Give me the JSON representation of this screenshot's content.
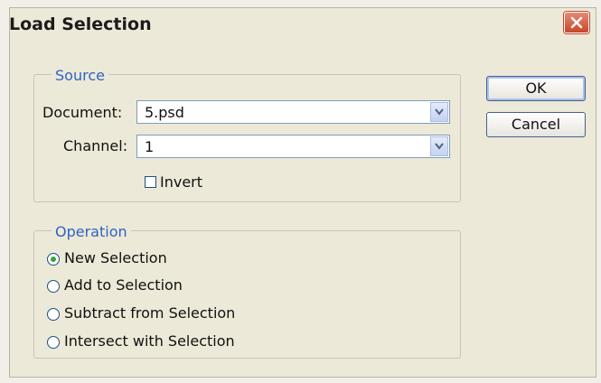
{
  "window": {
    "title": "Load Selection"
  },
  "source": {
    "legend": "Source",
    "document_label": "Document:",
    "document_value": "5.psd",
    "channel_label": "Channel:",
    "channel_value": "1",
    "invert_label": "Invert",
    "invert_checked": false
  },
  "operation": {
    "legend": "Operation",
    "options": [
      {
        "label": "New Selection",
        "selected": true
      },
      {
        "label": "Add to Selection",
        "selected": false
      },
      {
        "label": "Subtract from Selection",
        "selected": false
      },
      {
        "label": "Intersect with Selection",
        "selected": false
      }
    ]
  },
  "buttons": {
    "ok": "OK",
    "cancel": "Cancel"
  },
  "colors": {
    "legend_text": "#2f63c4",
    "close_button": "#c8462a",
    "dialog_bg": "#ece9d8"
  }
}
